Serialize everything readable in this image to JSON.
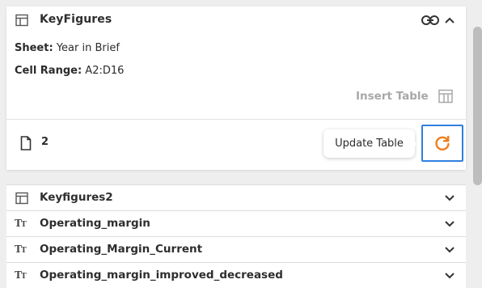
{
  "card": {
    "title": "KeyFigures",
    "sheet_label": "Sheet:",
    "sheet_value": "Year in Brief",
    "range_label": "Cell Range:",
    "range_value": "A2:D16",
    "insert_label": "Insert Table",
    "page_count": "2",
    "tooltip": "Update Table"
  },
  "list": {
    "items": [
      {
        "label": "Keyfigures2",
        "icon": "table-icon"
      },
      {
        "label": "Operating_margin",
        "icon": "text-icon"
      },
      {
        "label": "Operating_Margin_Current",
        "icon": "text-icon"
      },
      {
        "label": "Operating_margin_improved_decreased",
        "icon": "text-icon"
      }
    ]
  },
  "colors": {
    "accent_orange": "#f07d1a",
    "focus_blue": "#2f7fe0"
  }
}
